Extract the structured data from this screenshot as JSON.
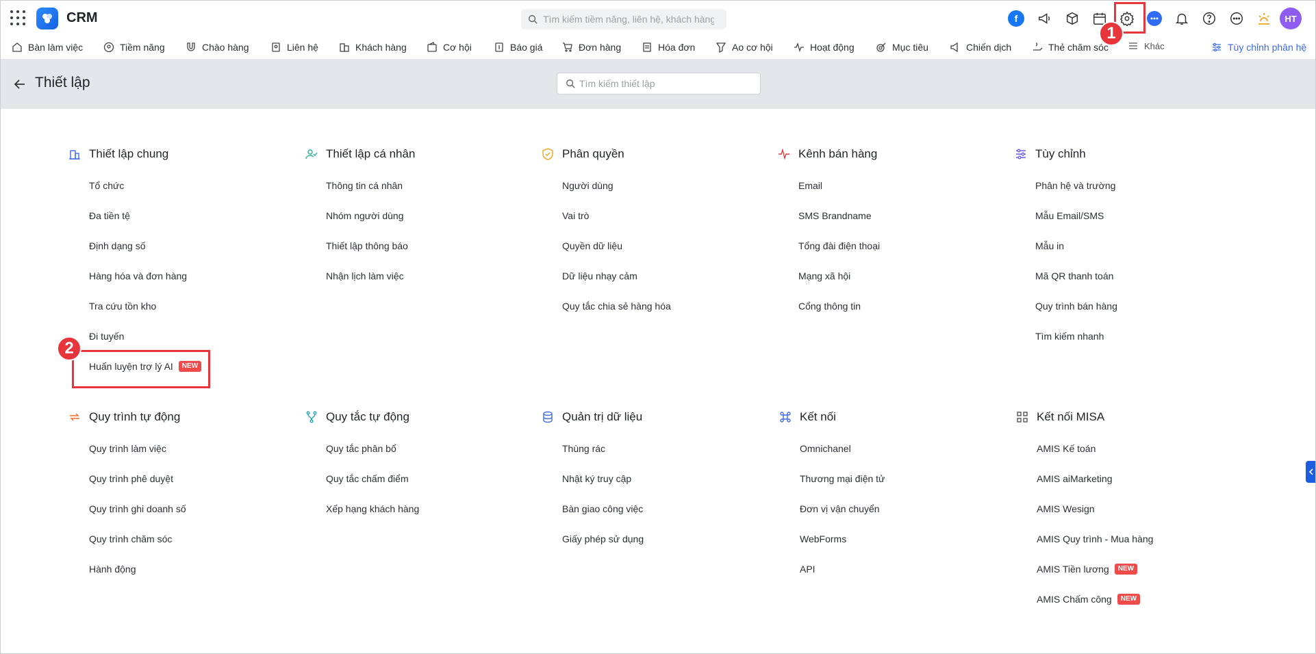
{
  "app": {
    "title": "CRM",
    "avatar_initials": "HT",
    "search_placeholder": "Tìm kiếm tiềm năng, liên hệ, khách hàng"
  },
  "nav": {
    "items": [
      "Bàn làm việc",
      "Tiềm năng",
      "Chào hàng",
      "Liên hệ",
      "Khách hàng",
      "Cơ hội",
      "Báo giá",
      "Đơn hàng",
      "Hóa đơn",
      "Ao cơ hội",
      "Hoạt động",
      "Mục tiêu",
      "Chiến dịch",
      "Thẻ chăm sóc",
      "Khác"
    ],
    "customize": "Tùy chỉnh phân hệ"
  },
  "settings": {
    "title": "Thiết lập",
    "search_placeholder": "Tìm kiếm thiết lập"
  },
  "sections": [
    {
      "title": "Thiết lập chung",
      "icon": "building-icon",
      "items": [
        {
          "label": "Tổ chức"
        },
        {
          "label": "Đa tiền tệ"
        },
        {
          "label": "Định dạng số"
        },
        {
          "label": "Hàng hóa và đơn hàng"
        },
        {
          "label": "Tra cứu tồn kho"
        },
        {
          "label": "Đi tuyến"
        },
        {
          "label": "Huấn luyện trợ lý AI",
          "badge": "NEW"
        }
      ]
    },
    {
      "title": "Thiết lập cá nhân",
      "icon": "user-check-icon",
      "items": [
        {
          "label": "Thông tin cá nhân"
        },
        {
          "label": "Nhóm người dùng"
        },
        {
          "label": "Thiết lập thông báo"
        },
        {
          "label": "Nhận lịch làm việc"
        }
      ]
    },
    {
      "title": "Phân quyền",
      "icon": "shield-icon",
      "items": [
        {
          "label": "Người dùng"
        },
        {
          "label": "Vai trò"
        },
        {
          "label": "Quyền dữ liệu"
        },
        {
          "label": "Dữ liệu nhạy cảm"
        },
        {
          "label": "Quy tắc chia sẻ hàng hóa"
        }
      ]
    },
    {
      "title": "Kênh bán hàng",
      "icon": "activity-icon",
      "items": [
        {
          "label": "Email"
        },
        {
          "label": "SMS Brandname"
        },
        {
          "label": "Tổng đài điện thoại"
        },
        {
          "label": "Mạng xã hội"
        },
        {
          "label": "Cổng thông tin"
        }
      ]
    },
    {
      "title": "Tùy chỉnh",
      "icon": "sliders-icon",
      "items": [
        {
          "label": "Phân hệ và trường"
        },
        {
          "label": "Mẫu Email/SMS"
        },
        {
          "label": "Mẫu in"
        },
        {
          "label": "Mã QR thanh toán"
        },
        {
          "label": "Quy trình bán hàng"
        },
        {
          "label": "Tìm kiếm nhanh"
        }
      ]
    },
    {
      "title": "Quy trình tự động",
      "icon": "refresh-icon",
      "items": [
        {
          "label": "Quy trình làm việc"
        },
        {
          "label": "Quy trình phê duyệt"
        },
        {
          "label": "Quy trình ghi doanh số"
        },
        {
          "label": "Quy trình chăm sóc"
        },
        {
          "label": "Hành động"
        }
      ]
    },
    {
      "title": "Quy tắc tự động",
      "icon": "git-branch-icon",
      "items": [
        {
          "label": "Quy tắc phân bổ"
        },
        {
          "label": "Quy tắc chấm điểm"
        },
        {
          "label": "Xếp hạng khách hàng"
        }
      ]
    },
    {
      "title": "Quản trị dữ liệu",
      "icon": "database-icon",
      "items": [
        {
          "label": "Thùng rác"
        },
        {
          "label": "Nhật ký truy cập"
        },
        {
          "label": "Bàn giao công việc"
        },
        {
          "label": "Giấy phép sử dụng"
        }
      ]
    },
    {
      "title": "Kết nối",
      "icon": "command-icon",
      "items": [
        {
          "label": "Omnichanel"
        },
        {
          "label": "Thương mại điện tử"
        },
        {
          "label": "Đơn vị vận chuyển"
        },
        {
          "label": "WebForms"
        },
        {
          "label": "API"
        }
      ]
    },
    {
      "title": "Kết nối MISA",
      "icon": "grid-icon",
      "items": [
        {
          "label": "AMIS Kế toán"
        },
        {
          "label": "AMIS aiMarketing"
        },
        {
          "label": "AMIS Wesign"
        },
        {
          "label": "AMIS Quy trình - Mua hàng"
        },
        {
          "label": "AMIS Tiền lương",
          "badge": "NEW"
        },
        {
          "label": "AMIS Chấm công",
          "badge": "NEW"
        }
      ]
    }
  ],
  "annotations": {
    "step1": "1",
    "step2": "2"
  },
  "colors": {
    "accent": "#3f6bf2",
    "highlight": "#e8343b",
    "header_bg": "#e4e6ea"
  }
}
